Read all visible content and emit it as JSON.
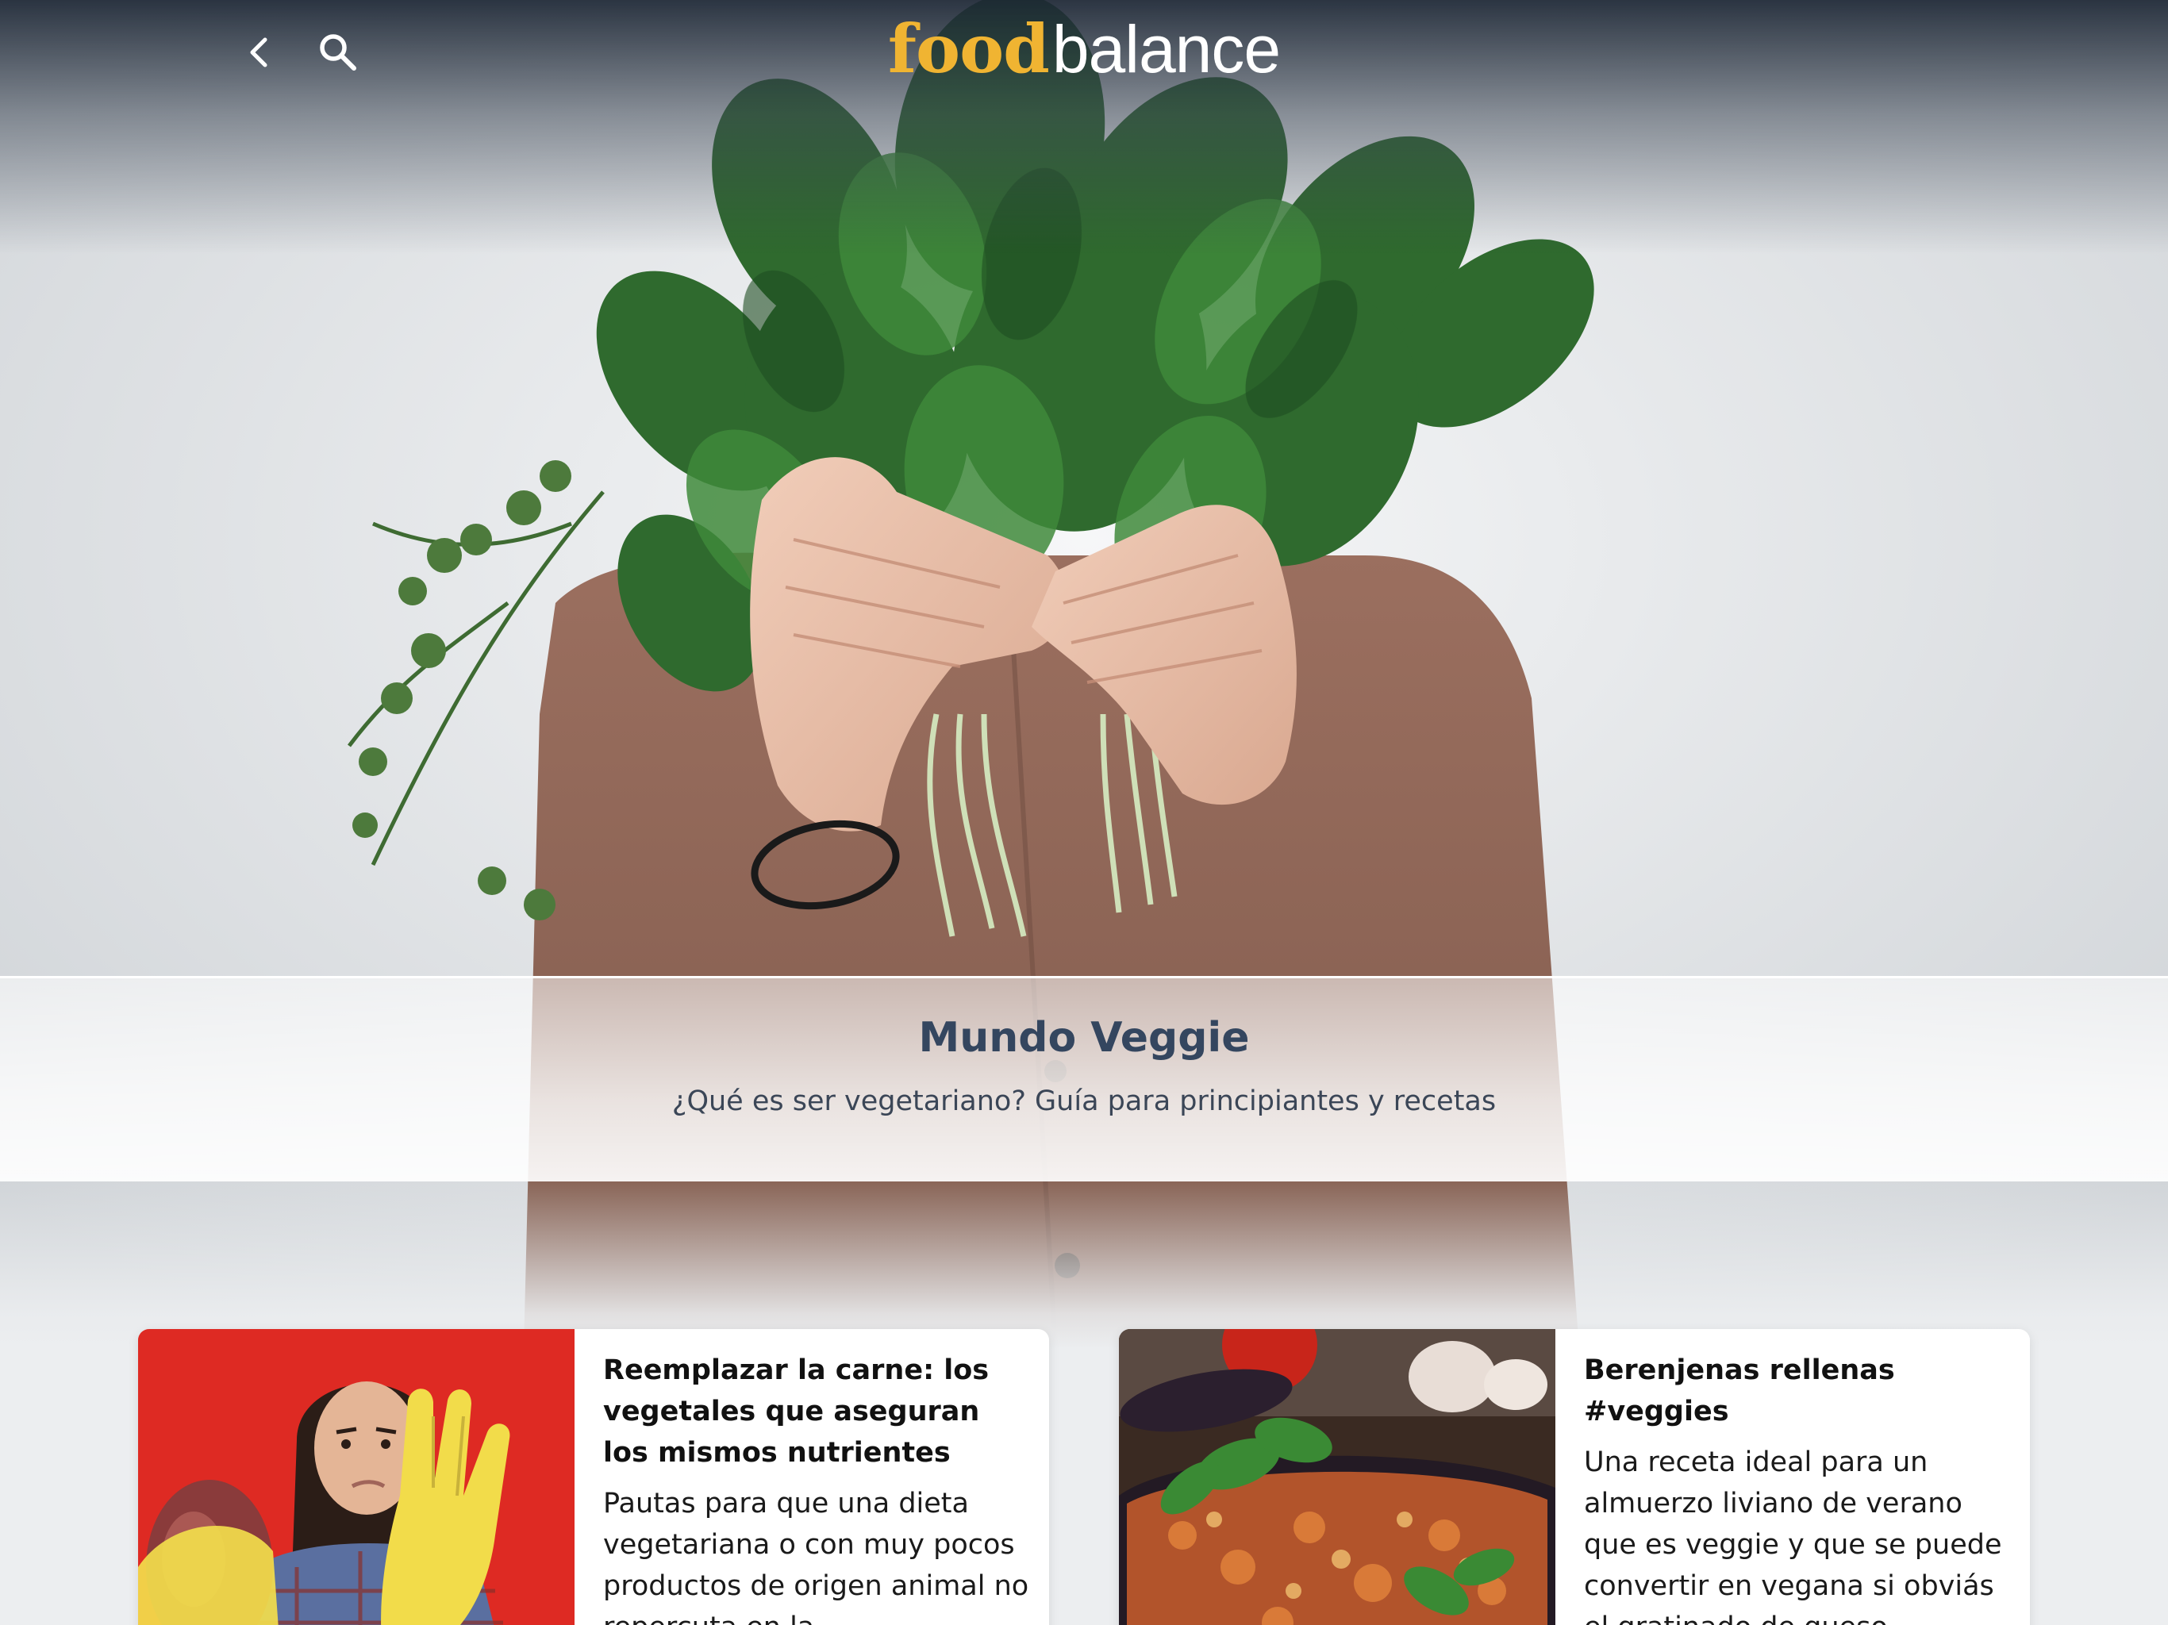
{
  "header": {
    "logo_part1": "food",
    "logo_part2": "balance",
    "logo_part1_color": "#f0b432",
    "logo_part2_color": "#ffffff",
    "back_icon": "chevron-left-icon",
    "search_icon": "search-icon"
  },
  "hero": {
    "title": "Mundo Veggie",
    "subtitle": "¿Qué es ser vegetariano? Guía para principiantes y recetas",
    "title_color": "#34465f"
  },
  "articles": [
    {
      "title": "Reemplazar la carne: los vegetales que aseguran los mismos nutrientes",
      "description": "Pautas para que una dieta vegetariana o con muy pocos productos de origen animal no repercuta en la",
      "thumbnail_bg": "#d8231f"
    },
    {
      "title": "Berenjenas rellenas #veggies",
      "description": "Una receta ideal para un almuerzo liviano de verano que es veggie y que se puede convertir en vegana si obviás el gratinado de queso",
      "thumbnail_bg": "#3a2a22"
    }
  ]
}
